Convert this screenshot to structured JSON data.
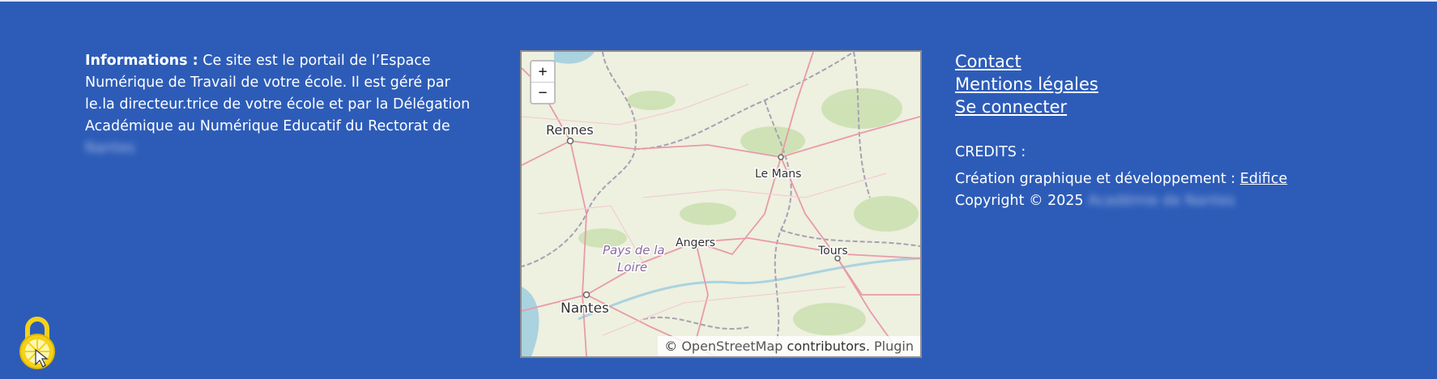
{
  "info": {
    "label": "Informations :",
    "text": "Ce site est le portail de l’Espace Numérique de Travail de votre école. Il est géré par le.la directeur.trice de votre école et par la Délégation Académique au Numérique Educatif du Rectorat de",
    "blurred_text": "Nantes"
  },
  "map": {
    "zoom_in": "+",
    "zoom_out": "−",
    "attribution_prefix": "©",
    "attribution_link": "OpenStreetMap",
    "attribution_mid": "contributors.",
    "attribution_plugin": "Plugin",
    "places": [
      "Rennes",
      "Le Mans",
      "Angers",
      "Pays de la",
      "Loire",
      "Nantes",
      "Tours"
    ]
  },
  "links": [
    "Contact",
    "Mentions légales",
    "Se connecter"
  ],
  "credits": {
    "title": "CREDITS :",
    "creation_label": "Création graphique et développement :",
    "creation_link": "Edifice",
    "copyright": "Copyright © 2025",
    "copyright_blurred": "Académie de Nantes"
  },
  "colors": {
    "background": "#2d5cb8",
    "text": "#ffffff",
    "lock_yellow": "#f5d21a"
  }
}
